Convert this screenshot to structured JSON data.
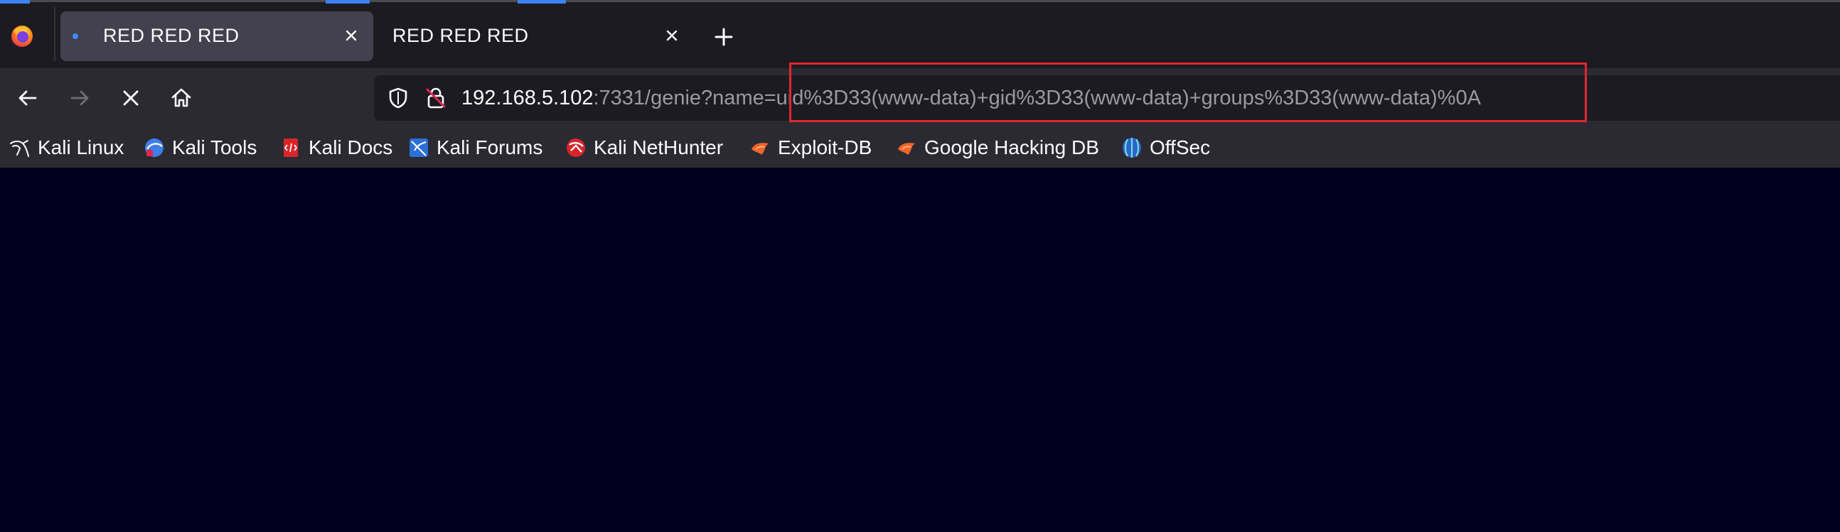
{
  "tabs": [
    {
      "title": "RED RED RED",
      "active": true
    },
    {
      "title": "RED RED RED",
      "active": false
    }
  ],
  "urlbar": {
    "host": "192.168.5.102",
    "rest": ":7331/genie?name=uid%3D33(www-data)+gid%3D33(www-data)+groups%3D33(www-data)%0A"
  },
  "bookmarks": [
    {
      "label": "Kali Linux",
      "icon": "kali-dragon-icon"
    },
    {
      "label": "Kali Tools",
      "icon": "kali-tools-icon"
    },
    {
      "label": "Kali Docs",
      "icon": "kali-docs-icon"
    },
    {
      "label": "Kali Forums",
      "icon": "kali-forums-icon"
    },
    {
      "label": "Kali NetHunter",
      "icon": "kali-nethunter-icon"
    },
    {
      "label": "Exploit-DB",
      "icon": "exploit-db-icon"
    },
    {
      "label": "Google Hacking DB",
      "icon": "ghdb-icon"
    },
    {
      "label": "OffSec",
      "icon": "offsec-icon"
    }
  ],
  "colors": {
    "page_background": "#01001e",
    "toolbar": "#2b2a33",
    "tabstrip": "#1c1b22",
    "active_tab": "#42414d",
    "highlight_box": "#e0272f",
    "accent": "#3b82f6"
  }
}
